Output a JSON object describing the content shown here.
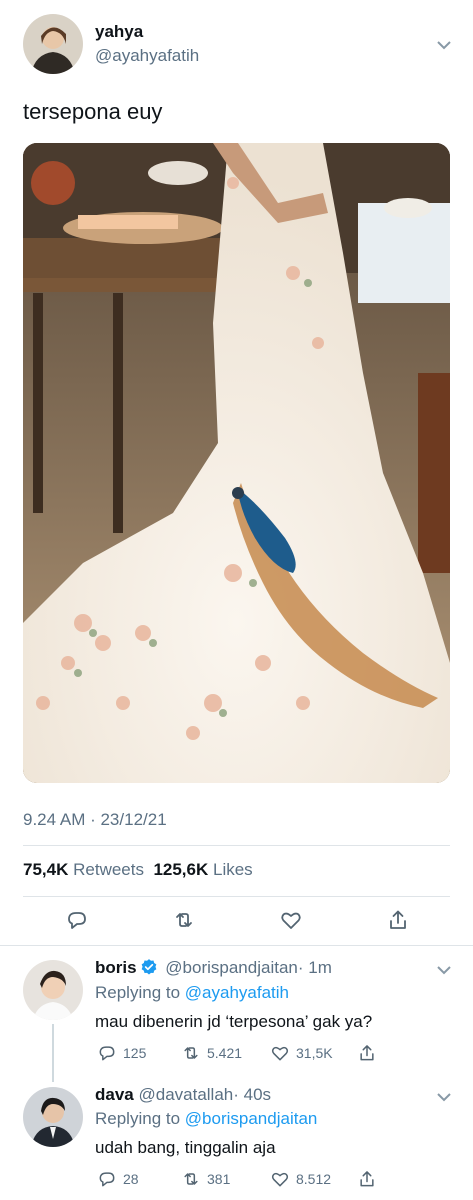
{
  "tweet": {
    "author_name": "yahya",
    "author_handle": "@ayahyafatih",
    "text": "tersepona euy",
    "timestamp": "9.24 AM · 23/12/21",
    "retweets_count": "75,4K",
    "retweets_label": "Retweets",
    "likes_count": "125,6K",
    "likes_label": "Likes"
  },
  "actions": [
    "reply-icon",
    "retweet-icon",
    "like-icon",
    "share-icon"
  ],
  "replies": [
    {
      "author_name": "boris",
      "verified": true,
      "author_handle": "@borispandjaitan",
      "time": "· 1m",
      "replying_prefix": "Replying to",
      "replying_to": "@ayahyafatih",
      "text": "mau dibenerin jd ‘terpesona’ gak ya?",
      "reply_count": "125",
      "retweet_count": "5.421",
      "like_count": "31,5K"
    },
    {
      "author_name": "dava",
      "verified": false,
      "author_handle": "@davatallah",
      "time": "· 40s",
      "replying_prefix": "Replying to",
      "replying_to": "@borispandjaitan",
      "text": "udah bang, tinggalin aja",
      "reply_count": "28",
      "retweet_count": "381",
      "like_count": "8.512"
    }
  ],
  "colors": {
    "accent": "#1d9bf0",
    "secondary_text": "#5b7083",
    "primary_text": "#0f1419",
    "divider": "#dfe4e8"
  }
}
